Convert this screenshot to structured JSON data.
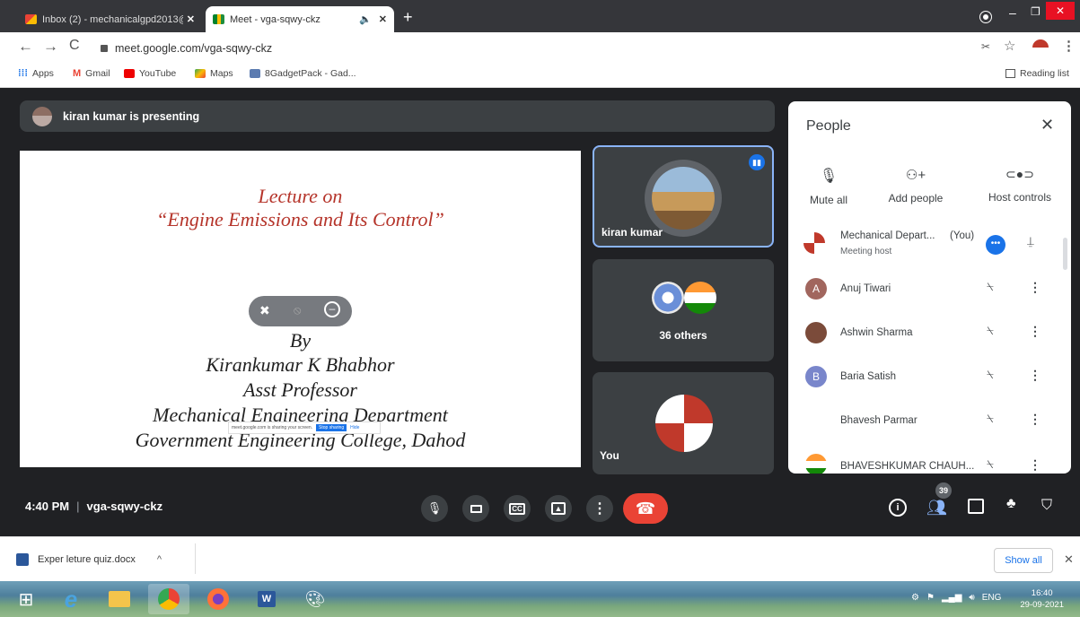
{
  "browser": {
    "tabs": [
      {
        "title": "Inbox (2) - mechanicalgpd2013@",
        "icon": "gmail-icon"
      },
      {
        "title": "Meet - vga-sqwy-ckz",
        "icon": "meet-icon"
      }
    ],
    "url": "meet.google.com/vga-sqwy-ckz",
    "bookmarks": [
      "Apps",
      "Gmail",
      "YouTube",
      "Maps",
      "8GadgetPack - Gad..."
    ],
    "reading_list": "Reading list"
  },
  "meet": {
    "presenting": "kiran kumar is presenting",
    "slide": {
      "line1": "Lecture on",
      "line2": "“Engine Emissions and Its Control”",
      "line3": "By",
      "line4": "Kirankumar K Bhabhor",
      "line5": "Asst Professor",
      "line6": "Mechanical Engineering Department",
      "line7": "Government Engineering College, Dahod"
    },
    "share_popup": {
      "text": "meet.google.com is sharing your screen.",
      "stop": "Stop sharing",
      "hide": "Hide"
    },
    "tiles": [
      {
        "name": "kiran kumar"
      },
      {
        "name": "36 others"
      },
      {
        "name": "You"
      }
    ],
    "time": "4:40 PM",
    "meeting_code": "vga-sqwy-ckz",
    "people_count": "39"
  },
  "people_panel": {
    "title": "People",
    "actions": [
      "Mute all",
      "Add people",
      "Host controls"
    ],
    "participants": [
      {
        "name": "Mechanical Depart...",
        "tag": "(You)",
        "sub": "Meeting host",
        "avatar": "",
        "color": "#c0392b"
      },
      {
        "name": "Anuj Tiwari",
        "avatar": "A",
        "color": "#a1665e"
      },
      {
        "name": "Ashwin Sharma",
        "avatar": "",
        "color": "#7b4b3a"
      },
      {
        "name": "Baria Satish",
        "avatar": "B",
        "color": "#7986cb"
      },
      {
        "name": "Bhavesh Parmar",
        "avatar": "",
        "color": "#d9b38c"
      },
      {
        "name": "BHAVESHKUMAR CHAUH...",
        "avatar": "",
        "color": "#ff9933"
      }
    ]
  },
  "downloads": {
    "file": "Exper leture quiz.docx",
    "show_all": "Show all"
  },
  "taskbar": {
    "lang": "ENG",
    "time": "16:40",
    "date": "29-09-2021"
  }
}
